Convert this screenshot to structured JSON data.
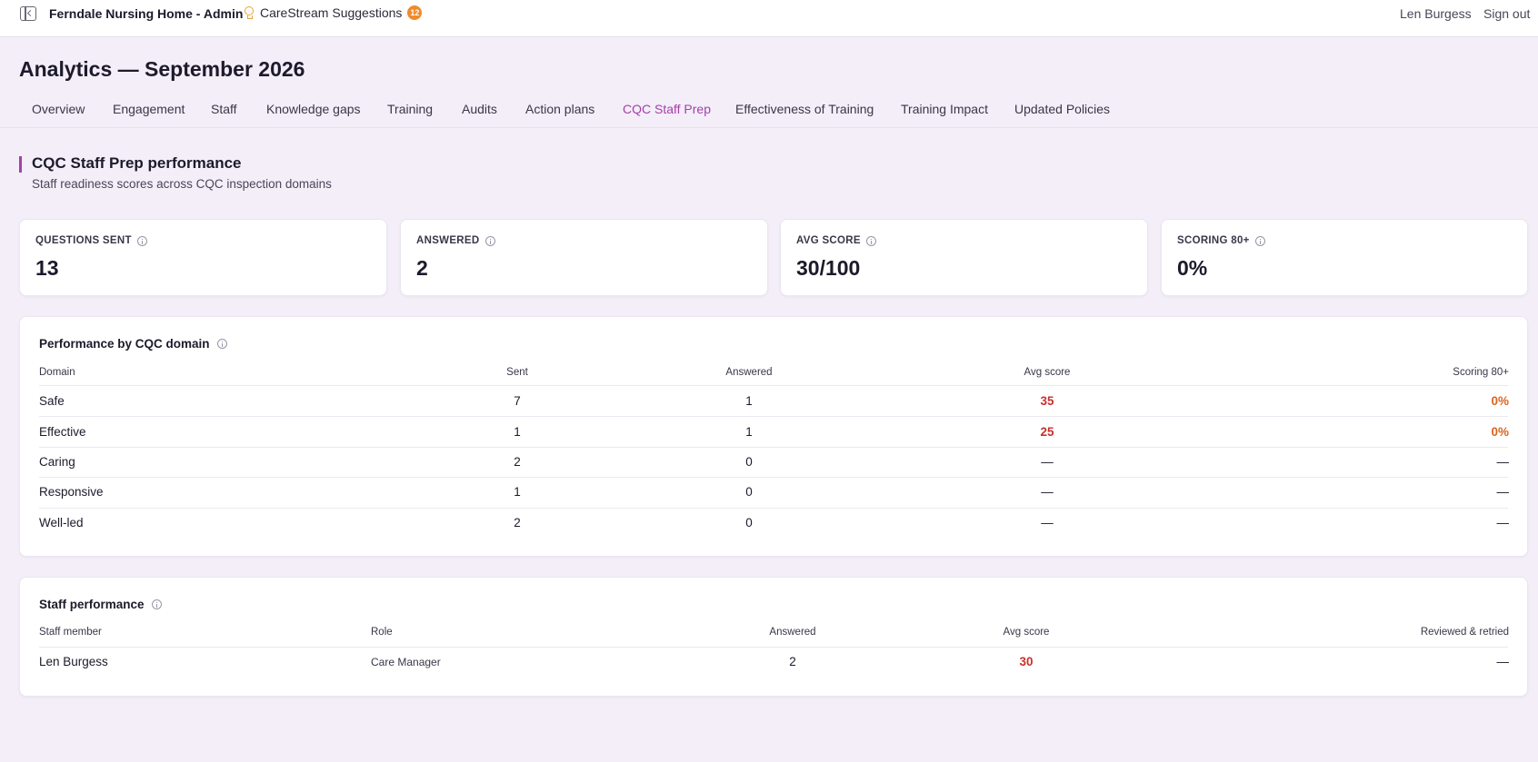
{
  "topbar": {
    "app_title": "Ferndale Nursing Home - Admin",
    "suggestions_label": "CareStream Suggestions",
    "suggestions_count": "12",
    "user_name": "Len Burgess",
    "signout_label": "Sign out",
    "accent": "#f08a2c"
  },
  "page": {
    "title": "Analytics — September 2026"
  },
  "tabs": [
    {
      "label": "Overview"
    },
    {
      "label": "Engagement"
    },
    {
      "label": "Staff"
    },
    {
      "label": "Knowledge gaps"
    },
    {
      "label": "Training"
    },
    {
      "label": "Audits"
    },
    {
      "label": "Action plans"
    },
    {
      "label": "CQC Staff Prep",
      "active": true
    },
    {
      "label": "Effectiveness of Training"
    },
    {
      "label": "Training Impact"
    },
    {
      "label": "Updated Policies"
    }
  ],
  "section": {
    "title": "CQC Staff Prep performance",
    "subtitle": "Staff readiness scores across CQC inspection domains",
    "accent": "#a63fa8"
  },
  "stats": [
    {
      "label": "QUESTIONS SENT",
      "value": "13"
    },
    {
      "label": "ANSWERED",
      "value": "2"
    },
    {
      "label": "AVG SCORE",
      "value": "30/100"
    },
    {
      "label": "SCORING 80+",
      "value": "0%"
    }
  ],
  "domain_table": {
    "title": "Performance by CQC domain",
    "headers": [
      "Domain",
      "Sent",
      "Answered",
      "Avg score",
      "Scoring 80+"
    ],
    "rows": [
      {
        "domain": "Safe",
        "sent": "7",
        "answered": "1",
        "avg": "35",
        "scoring": "0%"
      },
      {
        "domain": "Effective",
        "sent": "1",
        "answered": "1",
        "avg": "25",
        "scoring": "0%"
      },
      {
        "domain": "Caring",
        "sent": "2",
        "answered": "0",
        "avg": "—",
        "scoring": "—"
      },
      {
        "domain": "Responsive",
        "sent": "1",
        "answered": "0",
        "avg": "—",
        "scoring": "—"
      },
      {
        "domain": "Well-led",
        "sent": "2",
        "answered": "0",
        "avg": "—",
        "scoring": "—"
      }
    ]
  },
  "staff_table": {
    "title": "Staff performance",
    "headers": [
      "Staff member",
      "Role",
      "Answered",
      "Avg score",
      "Reviewed & retried"
    ],
    "rows": [
      {
        "name": "Len Burgess",
        "role": "Care Manager",
        "answered": "2",
        "avg": "30",
        "reviewed": "—"
      }
    ]
  },
  "colors": {
    "score_red": "#c9302c",
    "percent_orange": "#d9651f",
    "background": "#f3eef8"
  }
}
